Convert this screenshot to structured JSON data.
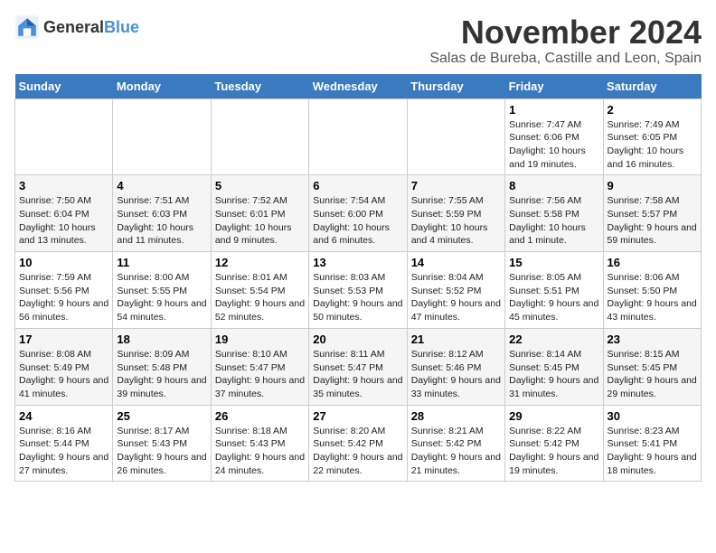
{
  "logo": {
    "text_general": "General",
    "text_blue": "Blue"
  },
  "title": "November 2024",
  "subtitle": "Salas de Bureba, Castille and Leon, Spain",
  "days_of_week": [
    "Sunday",
    "Monday",
    "Tuesday",
    "Wednesday",
    "Thursday",
    "Friday",
    "Saturday"
  ],
  "weeks": [
    [
      {
        "day": "",
        "info": ""
      },
      {
        "day": "",
        "info": ""
      },
      {
        "day": "",
        "info": ""
      },
      {
        "day": "",
        "info": ""
      },
      {
        "day": "",
        "info": ""
      },
      {
        "day": "1",
        "info": "Sunrise: 7:47 AM\nSunset: 6:06 PM\nDaylight: 10 hours and 19 minutes."
      },
      {
        "day": "2",
        "info": "Sunrise: 7:49 AM\nSunset: 6:05 PM\nDaylight: 10 hours and 16 minutes."
      }
    ],
    [
      {
        "day": "3",
        "info": "Sunrise: 7:50 AM\nSunset: 6:04 PM\nDaylight: 10 hours and 13 minutes."
      },
      {
        "day": "4",
        "info": "Sunrise: 7:51 AM\nSunset: 6:03 PM\nDaylight: 10 hours and 11 minutes."
      },
      {
        "day": "5",
        "info": "Sunrise: 7:52 AM\nSunset: 6:01 PM\nDaylight: 10 hours and 9 minutes."
      },
      {
        "day": "6",
        "info": "Sunrise: 7:54 AM\nSunset: 6:00 PM\nDaylight: 10 hours and 6 minutes."
      },
      {
        "day": "7",
        "info": "Sunrise: 7:55 AM\nSunset: 5:59 PM\nDaylight: 10 hours and 4 minutes."
      },
      {
        "day": "8",
        "info": "Sunrise: 7:56 AM\nSunset: 5:58 PM\nDaylight: 10 hours and 1 minute."
      },
      {
        "day": "9",
        "info": "Sunrise: 7:58 AM\nSunset: 5:57 PM\nDaylight: 9 hours and 59 minutes."
      }
    ],
    [
      {
        "day": "10",
        "info": "Sunrise: 7:59 AM\nSunset: 5:56 PM\nDaylight: 9 hours and 56 minutes."
      },
      {
        "day": "11",
        "info": "Sunrise: 8:00 AM\nSunset: 5:55 PM\nDaylight: 9 hours and 54 minutes."
      },
      {
        "day": "12",
        "info": "Sunrise: 8:01 AM\nSunset: 5:54 PM\nDaylight: 9 hours and 52 minutes."
      },
      {
        "day": "13",
        "info": "Sunrise: 8:03 AM\nSunset: 5:53 PM\nDaylight: 9 hours and 50 minutes."
      },
      {
        "day": "14",
        "info": "Sunrise: 8:04 AM\nSunset: 5:52 PM\nDaylight: 9 hours and 47 minutes."
      },
      {
        "day": "15",
        "info": "Sunrise: 8:05 AM\nSunset: 5:51 PM\nDaylight: 9 hours and 45 minutes."
      },
      {
        "day": "16",
        "info": "Sunrise: 8:06 AM\nSunset: 5:50 PM\nDaylight: 9 hours and 43 minutes."
      }
    ],
    [
      {
        "day": "17",
        "info": "Sunrise: 8:08 AM\nSunset: 5:49 PM\nDaylight: 9 hours and 41 minutes."
      },
      {
        "day": "18",
        "info": "Sunrise: 8:09 AM\nSunset: 5:48 PM\nDaylight: 9 hours and 39 minutes."
      },
      {
        "day": "19",
        "info": "Sunrise: 8:10 AM\nSunset: 5:47 PM\nDaylight: 9 hours and 37 minutes."
      },
      {
        "day": "20",
        "info": "Sunrise: 8:11 AM\nSunset: 5:47 PM\nDaylight: 9 hours and 35 minutes."
      },
      {
        "day": "21",
        "info": "Sunrise: 8:12 AM\nSunset: 5:46 PM\nDaylight: 9 hours and 33 minutes."
      },
      {
        "day": "22",
        "info": "Sunrise: 8:14 AM\nSunset: 5:45 PM\nDaylight: 9 hours and 31 minutes."
      },
      {
        "day": "23",
        "info": "Sunrise: 8:15 AM\nSunset: 5:45 PM\nDaylight: 9 hours and 29 minutes."
      }
    ],
    [
      {
        "day": "24",
        "info": "Sunrise: 8:16 AM\nSunset: 5:44 PM\nDaylight: 9 hours and 27 minutes."
      },
      {
        "day": "25",
        "info": "Sunrise: 8:17 AM\nSunset: 5:43 PM\nDaylight: 9 hours and 26 minutes."
      },
      {
        "day": "26",
        "info": "Sunrise: 8:18 AM\nSunset: 5:43 PM\nDaylight: 9 hours and 24 minutes."
      },
      {
        "day": "27",
        "info": "Sunrise: 8:20 AM\nSunset: 5:42 PM\nDaylight: 9 hours and 22 minutes."
      },
      {
        "day": "28",
        "info": "Sunrise: 8:21 AM\nSunset: 5:42 PM\nDaylight: 9 hours and 21 minutes."
      },
      {
        "day": "29",
        "info": "Sunrise: 8:22 AM\nSunset: 5:42 PM\nDaylight: 9 hours and 19 minutes."
      },
      {
        "day": "30",
        "info": "Sunrise: 8:23 AM\nSunset: 5:41 PM\nDaylight: 9 hours and 18 minutes."
      }
    ]
  ]
}
